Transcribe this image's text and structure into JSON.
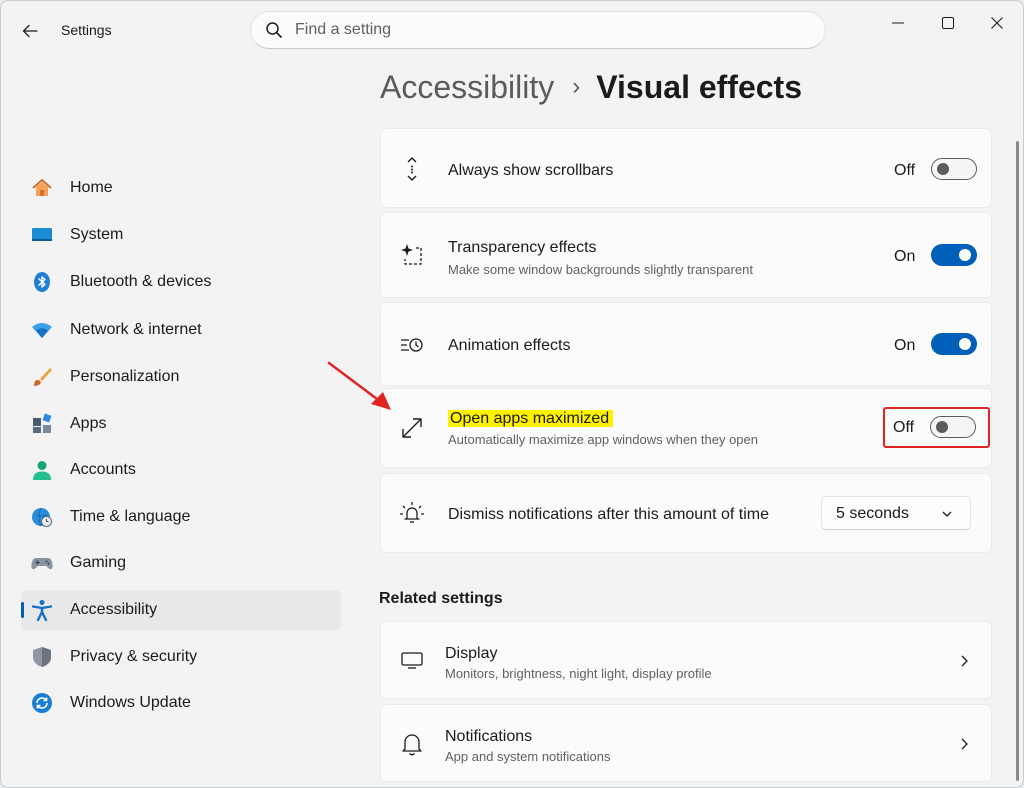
{
  "window": {
    "title": "Settings"
  },
  "search": {
    "placeholder": "Find a setting"
  },
  "sidebar": {
    "items": [
      {
        "label": "Home",
        "icon": "home-icon"
      },
      {
        "label": "System",
        "icon": "monitor-icon"
      },
      {
        "label": "Bluetooth & devices",
        "icon": "bluetooth-icon"
      },
      {
        "label": "Network & internet",
        "icon": "wifi-icon"
      },
      {
        "label": "Personalization",
        "icon": "brush-icon"
      },
      {
        "label": "Apps",
        "icon": "apps-icon"
      },
      {
        "label": "Accounts",
        "icon": "person-icon"
      },
      {
        "label": "Time & language",
        "icon": "globe-clock-icon"
      },
      {
        "label": "Gaming",
        "icon": "gamepad-icon"
      },
      {
        "label": "Accessibility",
        "icon": "accessibility-icon",
        "selected": true
      },
      {
        "label": "Privacy & security",
        "icon": "shield-icon"
      },
      {
        "label": "Windows Update",
        "icon": "update-icon"
      }
    ]
  },
  "breadcrumb": {
    "parent": "Accessibility",
    "separator": "›",
    "current": "Visual effects"
  },
  "settings": [
    {
      "title": "Always show scrollbars",
      "description": "",
      "state_label": "Off",
      "on": false,
      "icon": "scrollbar-arrows-icon"
    },
    {
      "title": "Transparency effects",
      "description": "Make some window backgrounds slightly transparent",
      "state_label": "On",
      "on": true,
      "icon": "sparkle-frame-icon"
    },
    {
      "title": "Animation effects",
      "description": "",
      "state_label": "On",
      "on": true,
      "icon": "animation-icon"
    },
    {
      "title": "Open apps maximized",
      "description": "Automatically maximize app windows when they open",
      "state_label": "Off",
      "on": false,
      "icon": "maximize-arrow-icon",
      "highlighted": true
    },
    {
      "title": "Dismiss notifications after this amount of time",
      "icon": "notification-timer-icon",
      "dropdown_value": "5 seconds"
    }
  ],
  "related": {
    "title": "Related settings",
    "items": [
      {
        "title": "Display",
        "description": "Monitors, brightness, night light, display profile",
        "icon": "display-icon"
      },
      {
        "title": "Notifications",
        "description": "App and system notifications",
        "icon": "bell-icon"
      }
    ]
  },
  "colors": {
    "accent": "#005fb8",
    "highlight": "#fff200",
    "annotation": "#e02424"
  }
}
